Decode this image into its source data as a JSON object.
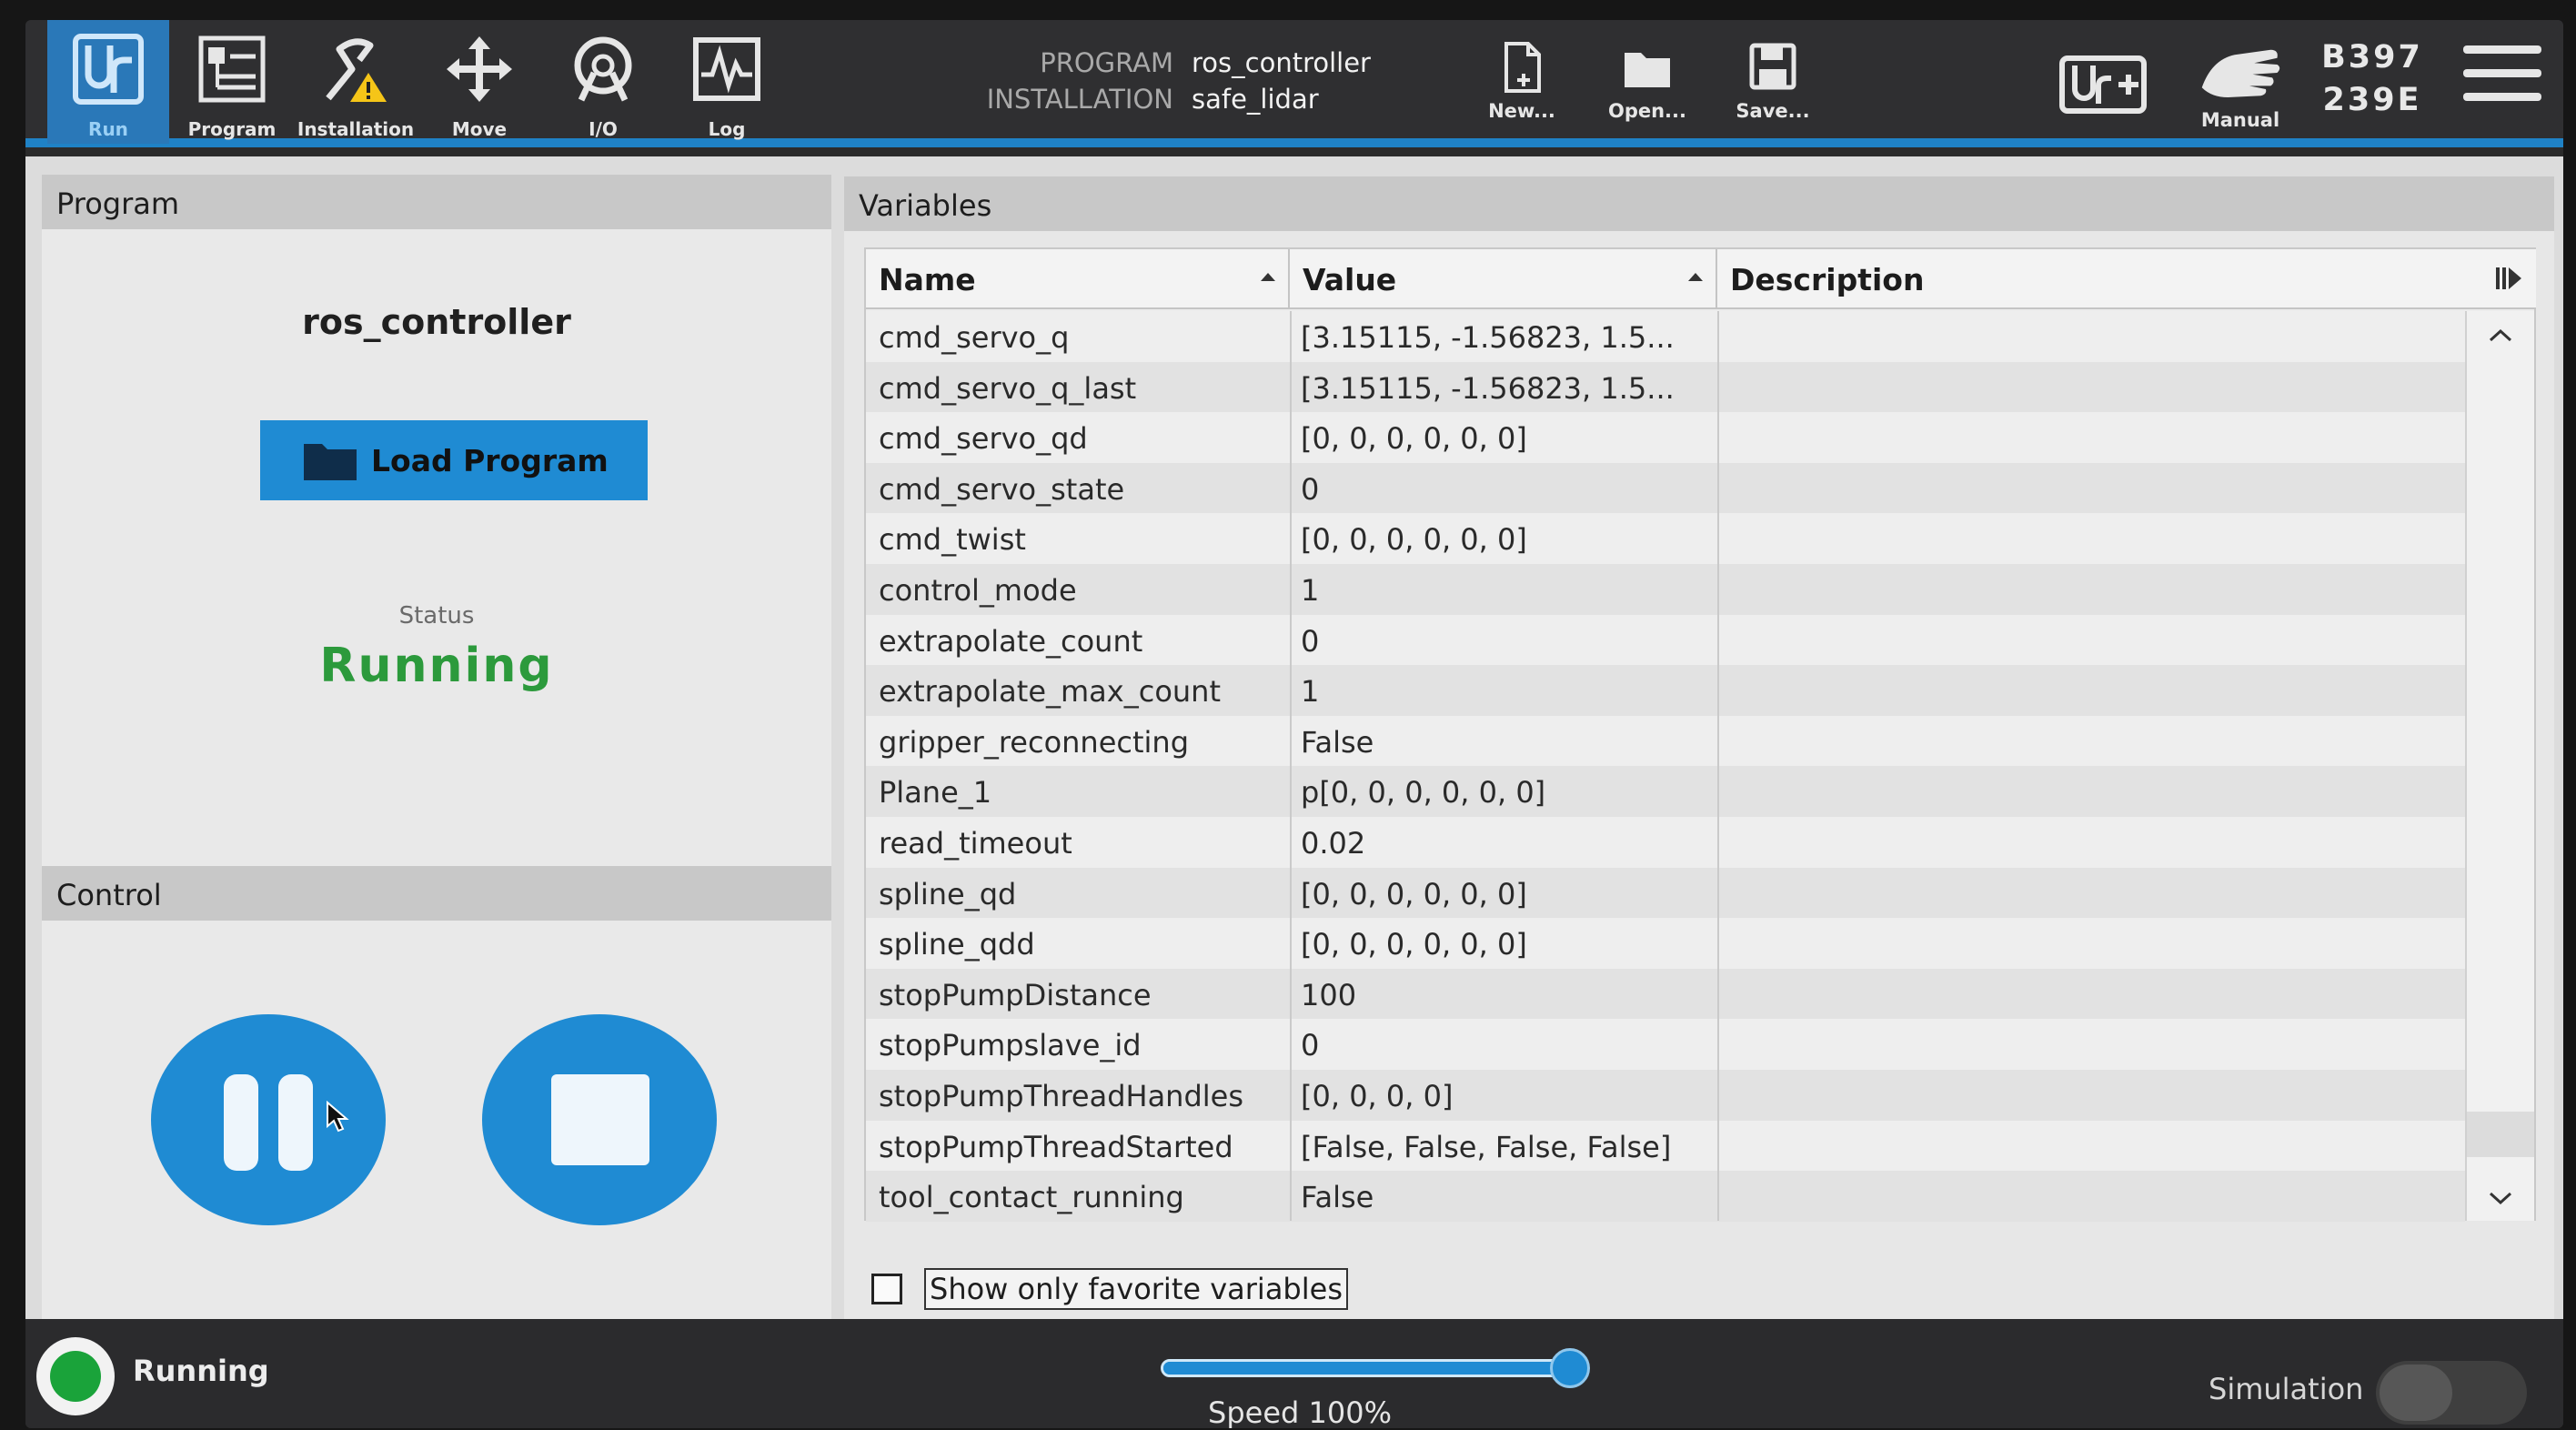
{
  "nav": {
    "tabs": [
      {
        "label": "Run",
        "icon": "ur-logo-icon",
        "active": true
      },
      {
        "label": "Program",
        "icon": "program-icon",
        "active": false
      },
      {
        "label": "Installation",
        "icon": "installation-icon",
        "active": false
      },
      {
        "label": "Move",
        "icon": "move-icon",
        "active": false
      },
      {
        "label": "I/O",
        "icon": "io-icon",
        "active": false
      },
      {
        "label": "Log",
        "icon": "log-icon",
        "active": false
      }
    ],
    "program_key": "PROGRAM",
    "program_value": "ros_controller",
    "installation_key": "INSTALLATION",
    "installation_value": "safe_lidar",
    "new_label": "New...",
    "open_label": "Open...",
    "save_label": "Save...",
    "manual_label": "Manual",
    "robot_id_line1": "B397",
    "robot_id_line2": "239E"
  },
  "program_panel": {
    "header": "Program",
    "program_name": "ros_controller",
    "load_button": "Load Program",
    "status_label": "Status",
    "status_value": "Running"
  },
  "control_panel": {
    "header": "Control"
  },
  "variables_panel": {
    "header": "Variables",
    "columns": [
      "Name",
      "Value",
      "Description"
    ],
    "rows": [
      {
        "name": "cmd_servo_q",
        "value": "[3.15115, -1.56823, 1.5..."
      },
      {
        "name": "cmd_servo_q_last",
        "value": "[3.15115, -1.56823, 1.5..."
      },
      {
        "name": "cmd_servo_qd",
        "value": "[0, 0, 0, 0, 0, 0]"
      },
      {
        "name": "cmd_servo_state",
        "value": "0"
      },
      {
        "name": "cmd_twist",
        "value": "[0, 0, 0, 0, 0, 0]"
      },
      {
        "name": "control_mode",
        "value": "1"
      },
      {
        "name": "extrapolate_count",
        "value": "0"
      },
      {
        "name": "extrapolate_max_count",
        "value": "1"
      },
      {
        "name": "gripper_reconnecting",
        "value": "False"
      },
      {
        "name": "Plane_1",
        "value": "p[0, 0, 0, 0, 0, 0]"
      },
      {
        "name": "read_timeout",
        "value": "0.02"
      },
      {
        "name": "spline_qd",
        "value": "[0, 0, 0, 0, 0, 0]"
      },
      {
        "name": "spline_qdd",
        "value": "[0, 0, 0, 0, 0, 0]"
      },
      {
        "name": "stopPumpDistance",
        "value": "100"
      },
      {
        "name": "stopPumpslave_id",
        "value": "0"
      },
      {
        "name": "stopPumpThreadHandles",
        "value": "[0, 0, 0, 0]"
      },
      {
        "name": "stopPumpThreadStarted",
        "value": "[False, False, False, False]"
      },
      {
        "name": "tool_contact_running",
        "value": "False"
      }
    ],
    "favorites_label": "Show only favorite variables",
    "favorites_checked": false
  },
  "footer": {
    "run_state": "Running",
    "speed_text": "Speed 100%",
    "speed_percent": 100,
    "simulation_label": "Simulation",
    "simulation_on": false
  },
  "colors": {
    "accent": "#1f8bd3",
    "running_green": "#2c9a3c",
    "topbar": "#2f2f31"
  }
}
